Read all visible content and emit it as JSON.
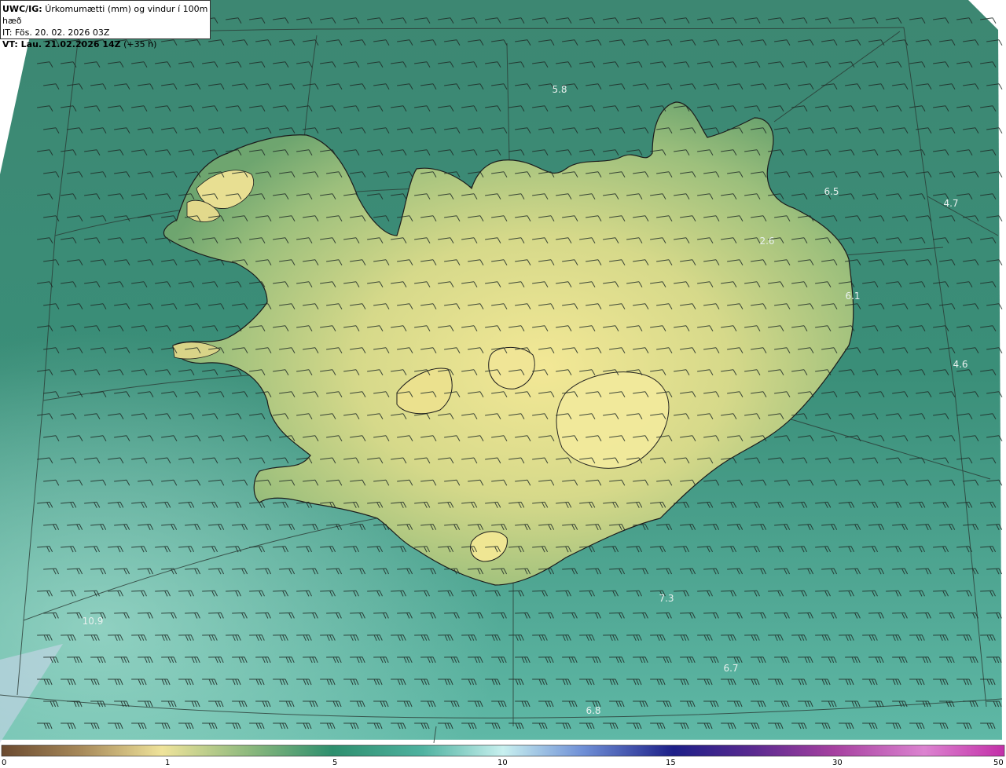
{
  "header": {
    "model": "UWC/IG:",
    "title": "Úrkomumætti (mm) og vindur í 100m hæð",
    "init_label": "IT: Fös. 20. 02. 2026 03Z",
    "valid_label": "VT: Lau. 21.02.2026 14Z",
    "lead_label": "(+35 h)"
  },
  "max_labels": [
    "5.8",
    "6.5",
    "4.7",
    "2.6",
    "6.1",
    "4.6",
    "7.3",
    "6.7",
    "6.8",
    "10.9"
  ],
  "colorbar": {
    "tick_labels": [
      "0",
      "1",
      "5",
      "10",
      "15",
      "30",
      "50"
    ],
    "colors": {
      "brown": "#7a5a3c",
      "tan": "#d2bc85",
      "yellow": "#f1e89a",
      "green": "#2f9a72",
      "cyan": "#b8ecec",
      "blue": "#2a2f9a",
      "purple": "#9b3a9a",
      "pink": "#ecaee0"
    }
  },
  "colors": {
    "ocean": "#3f8a74",
    "land_low": "#6f9a6a",
    "land_high": "#f1e89a",
    "coastline": "#1c1c1c",
    "wind_barb": "#1e2a26"
  }
}
